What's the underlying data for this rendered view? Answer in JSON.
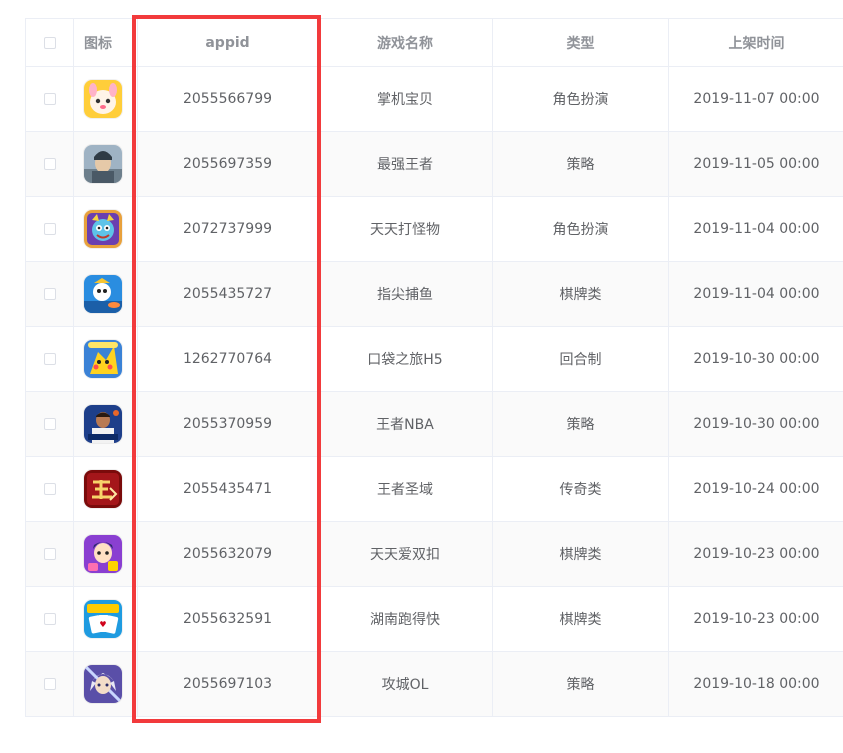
{
  "table": {
    "headers": {
      "icon": "图标",
      "appid": "appid",
      "name": "游戏名称",
      "type": "类型",
      "date": "上架时间"
    },
    "rows": [
      {
        "appid": "2055566799",
        "name": "掌机宝贝",
        "type": "角色扮演",
        "date": "2019-11-07 00:00",
        "icon": "cartoon-creature-icon"
      },
      {
        "appid": "2055697359",
        "name": "最强王者",
        "type": "策略",
        "date": "2019-11-05 00:00",
        "icon": "warrior-portrait-icon"
      },
      {
        "appid": "2072737999",
        "name": "天天打怪物",
        "type": "角色扮演",
        "date": "2019-11-04 00:00",
        "icon": "monster-face-icon"
      },
      {
        "appid": "2055435727",
        "name": "指尖捕鱼",
        "type": "棋牌类",
        "date": "2019-11-04 00:00",
        "icon": "fishing-game-icon"
      },
      {
        "appid": "1262770764",
        "name": "口袋之旅H5",
        "type": "回合制",
        "date": "2019-10-30 00:00",
        "icon": "pocket-monster-icon"
      },
      {
        "appid": "2055370959",
        "name": "王者NBA",
        "type": "策略",
        "date": "2019-10-30 00:00",
        "icon": "basketball-player-icon"
      },
      {
        "appid": "2055435471",
        "name": "王者圣域",
        "type": "传奇类",
        "date": "2019-10-24 00:00",
        "icon": "wangzhe-logo-icon"
      },
      {
        "appid": "2055632079",
        "name": "天天爱双扣",
        "type": "棋牌类",
        "date": "2019-10-23 00:00",
        "icon": "card-game-character-icon"
      },
      {
        "appid": "2055632591",
        "name": "湖南跑得快",
        "type": "棋牌类",
        "date": "2019-10-23 00:00",
        "icon": "playing-cards-icon"
      },
      {
        "appid": "2055697103",
        "name": "攻城OL",
        "type": "策略",
        "date": "2019-10-18 00:00",
        "icon": "white-haired-hero-icon"
      }
    ]
  },
  "colors": {
    "highlight_border": "#f23a3c",
    "header_text": "#909399",
    "cell_text": "#606266",
    "grid_line": "#ebeef5",
    "stripe": "#fafafa"
  }
}
